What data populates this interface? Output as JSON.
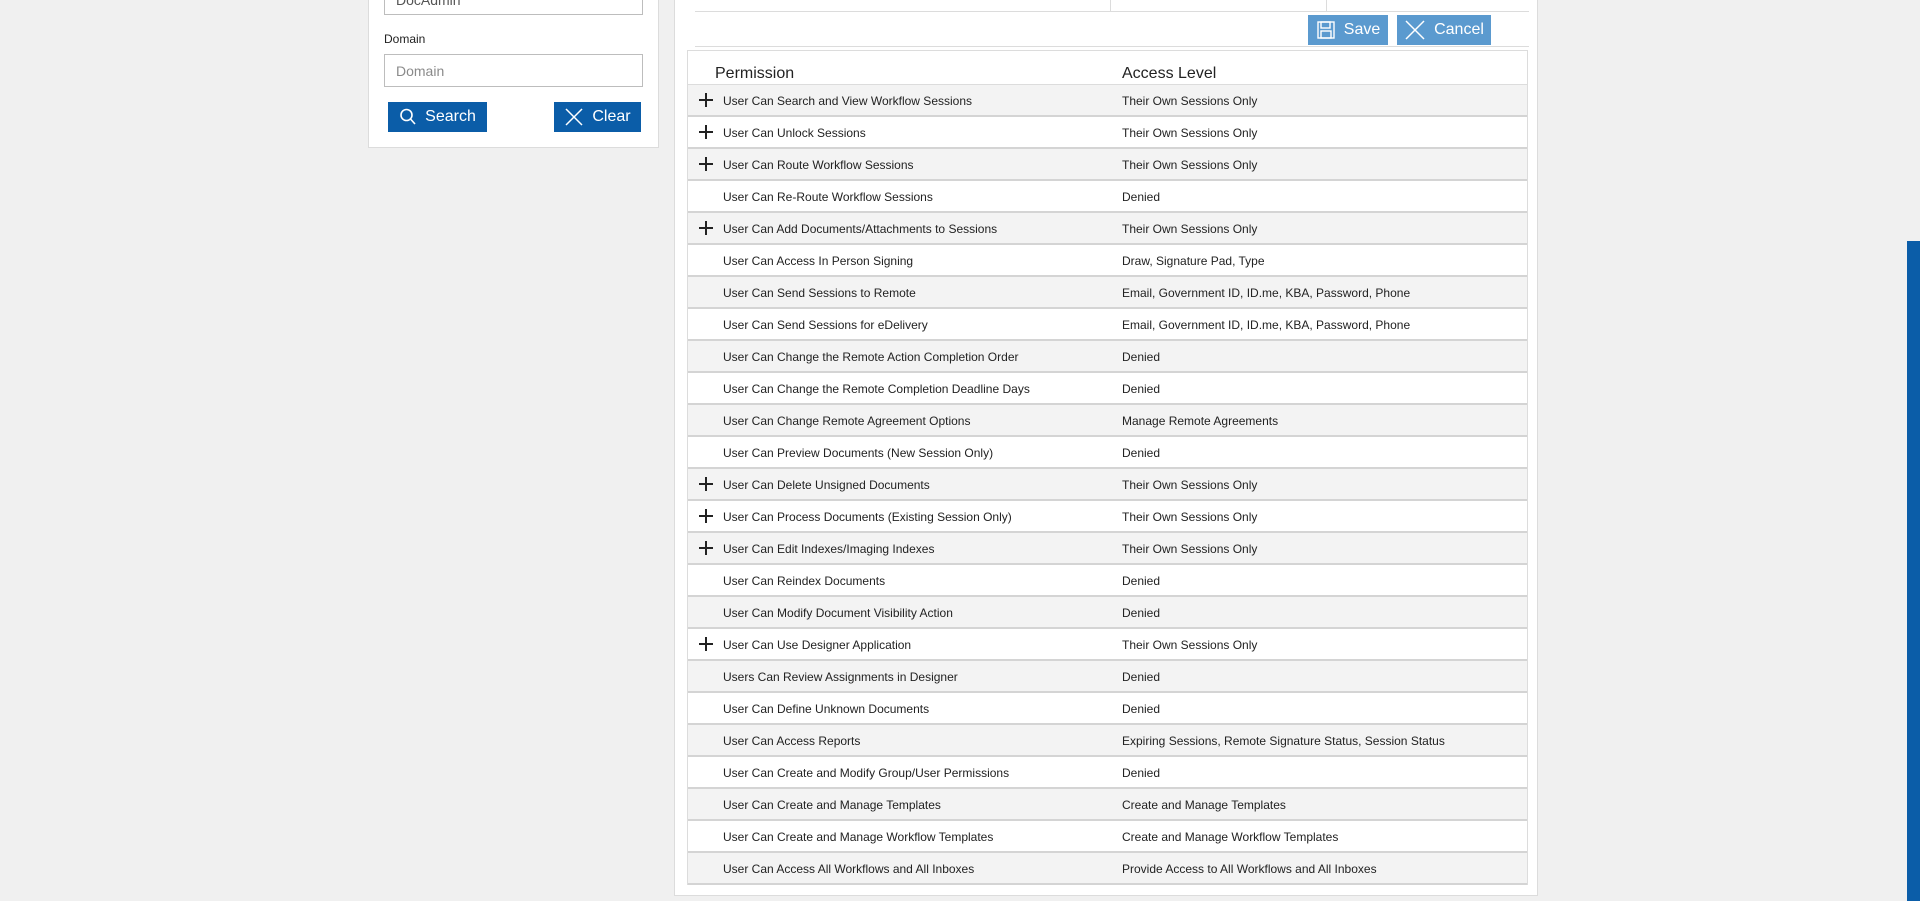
{
  "search_panel": {
    "user_value": "DocAdmin",
    "domain_label": "Domain",
    "domain_placeholder": "Domain",
    "search_label": "Search",
    "clear_label": "Clear"
  },
  "toolbar": {
    "save_label": "Save",
    "cancel_label": "Cancel"
  },
  "table": {
    "headers": {
      "permission": "Permission",
      "access": "Access Level"
    },
    "rows": [
      {
        "permission": "User Can Search and View Workflow Sessions",
        "access": "Their Own Sessions Only",
        "expandable": true
      },
      {
        "permission": "User Can Unlock Sessions",
        "access": "Their Own Sessions Only",
        "expandable": true
      },
      {
        "permission": "User Can Route Workflow Sessions",
        "access": "Their Own Sessions Only",
        "expandable": true
      },
      {
        "permission": "User Can Re-Route Workflow Sessions",
        "access": "Denied",
        "expandable": false
      },
      {
        "permission": "User Can Add Documents/Attachments to Sessions",
        "access": "Their Own Sessions Only",
        "expandable": true
      },
      {
        "permission": "User Can Access In Person Signing",
        "access": "Draw, Signature Pad, Type",
        "expandable": false
      },
      {
        "permission": "User Can Send Sessions to Remote",
        "access": "Email, Government ID, ID.me, KBA, Password, Phone",
        "expandable": false
      },
      {
        "permission": "User Can Send Sessions for eDelivery",
        "access": "Email, Government ID, ID.me, KBA, Password, Phone",
        "expandable": false
      },
      {
        "permission": "User Can Change the Remote Action Completion Order",
        "access": "Denied",
        "expandable": false
      },
      {
        "permission": "User Can Change the Remote Completion Deadline Days",
        "access": "Denied",
        "expandable": false
      },
      {
        "permission": "User Can Change Remote Agreement Options",
        "access": "Manage Remote Agreements",
        "expandable": false
      },
      {
        "permission": "User Can Preview Documents (New Session Only)",
        "access": "Denied",
        "expandable": false
      },
      {
        "permission": "User Can Delete Unsigned Documents",
        "access": "Their Own Sessions Only",
        "expandable": true
      },
      {
        "permission": "User Can Process Documents (Existing Session Only)",
        "access": "Their Own Sessions Only",
        "expandable": true
      },
      {
        "permission": "User Can Edit Indexes/Imaging Indexes",
        "access": "Their Own Sessions Only",
        "expandable": true
      },
      {
        "permission": "User Can Reindex Documents",
        "access": "Denied",
        "expandable": false
      },
      {
        "permission": "User Can Modify Document Visibility Action",
        "access": "Denied",
        "expandable": false
      },
      {
        "permission": "User Can Use Designer Application",
        "access": "Their Own Sessions Only",
        "expandable": true
      },
      {
        "permission": "Users Can Review Assignments in Designer",
        "access": "Denied",
        "expandable": false
      },
      {
        "permission": "User Can Define Unknown Documents",
        "access": "Denied",
        "expandable": false
      },
      {
        "permission": "User Can Access Reports",
        "access": "Expiring Sessions, Remote Signature Status, Session Status",
        "expandable": false
      },
      {
        "permission": "User Can Create and Modify Group/User Permissions",
        "access": "Denied",
        "expandable": false
      },
      {
        "permission": "User Can Create and Manage Templates",
        "access": "Create and Manage Templates",
        "expandable": false
      },
      {
        "permission": "User Can Create and Manage Workflow Templates",
        "access": "Create and Manage Workflow Templates",
        "expandable": false
      },
      {
        "permission": "User Can Access All Workflows and All Inboxes",
        "access": "Provide Access to All Workflows and All Inboxes",
        "expandable": false
      }
    ]
  },
  "colors": {
    "primary_button": "#0b5da8",
    "secondary_button": "#5b9acf",
    "accent_bar": "#0b5da8"
  }
}
